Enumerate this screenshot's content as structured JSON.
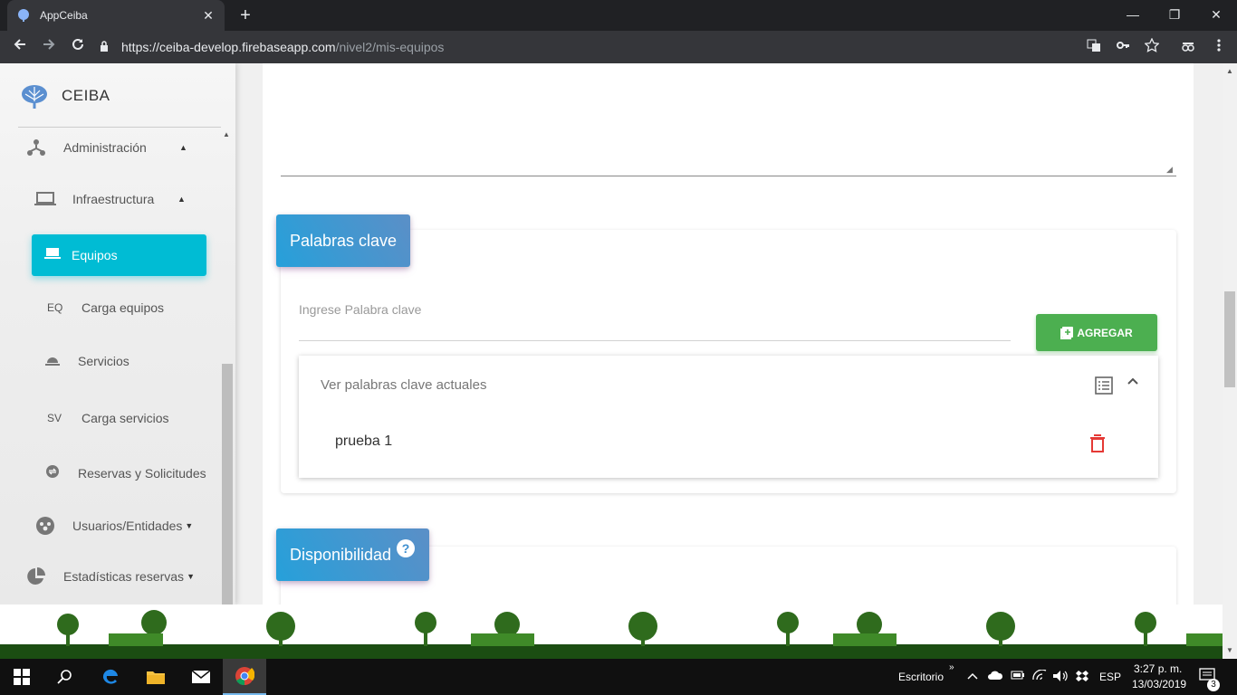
{
  "browser": {
    "tab_title": "AppCeiba",
    "tab_close": "✕",
    "new_tab": "+",
    "url_host": "https://ceiba-develop.firebaseapp.com",
    "url_path": "/nivel2/mis-equipos",
    "controls": {
      "minimize": "—",
      "restore": "❐",
      "close": "✕"
    }
  },
  "sidebar": {
    "brand": "CEIBA",
    "items": [
      {
        "label": "Administración",
        "icon": "hierarchy-icon",
        "caret": "▲"
      },
      {
        "label": "Infraestructura",
        "icon": "laptop-icon",
        "caret": "▲"
      },
      {
        "label": "Equipos",
        "icon": "laptop-icon",
        "active": true
      },
      {
        "label": "Carga equipos",
        "abbr": "EQ"
      },
      {
        "label": "Servicios",
        "icon": "room-service-icon"
      },
      {
        "label": "Carga servicios",
        "abbr": "SV"
      },
      {
        "label": "Reservas y Solicitudes",
        "icon": "swap-icon"
      },
      {
        "label": "Usuarios/Entidades",
        "icon": "group-icon",
        "caret": "▼"
      },
      {
        "label": "Estadísticas reservas",
        "icon": "pie-chart-icon",
        "caret": "▼"
      }
    ]
  },
  "keywords_card": {
    "title": "Palabras clave",
    "input_placeholder": "Ingrese Palabra clave",
    "add_button": "AGREGAR",
    "panel_title": "Ver palabras clave actuales",
    "items": [
      "prueba 1"
    ]
  },
  "availability_card": {
    "title": "Disponibilidad",
    "help_icon": "?"
  },
  "taskbar": {
    "desktop_label": "Escritorio",
    "language": "ESP",
    "time": "3:27 p. m.",
    "date": "13/03/2019",
    "notifications": "3"
  },
  "colors": {
    "accent_cyan": "#00bcd4",
    "card_header": "#26a0da",
    "add_green": "#4caf50",
    "delete_red": "#e53935"
  }
}
